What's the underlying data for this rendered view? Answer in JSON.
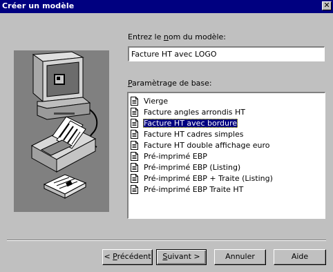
{
  "window": {
    "title": "Créer un modèle",
    "close_glyph": "✕"
  },
  "name_field": {
    "label_pre": "Entrez le ",
    "label_accel": "n",
    "label_post": "om du modèle:",
    "value": "Facture HT avec LOGO"
  },
  "base_list": {
    "label_accel": "P",
    "label_post": "aramètrage de base:",
    "selected_index": 2,
    "items": [
      "Vierge",
      "Facture angles arrondis HT",
      "Facture HT avec bordure",
      "Facture HT cadres simples",
      "Facture HT double affichage euro",
      "Pré-imprimé EBP",
      "Pré-imprimé EBP (Listing)",
      "Pré-imprimé EBP + Traite (Listing)",
      "Pré-imprimé EBP Traite HT"
    ]
  },
  "buttons": {
    "previous": {
      "pre": "< ",
      "accel": "P",
      "post": "récédent"
    },
    "next": {
      "accel": "S",
      "post": "uivant >"
    },
    "cancel": "Annuler",
    "help": "Aide"
  },
  "colors": {
    "titlebar": "#000080",
    "face": "#c0c0c0",
    "selection": "#000080",
    "illustration_bg": "#808080"
  }
}
